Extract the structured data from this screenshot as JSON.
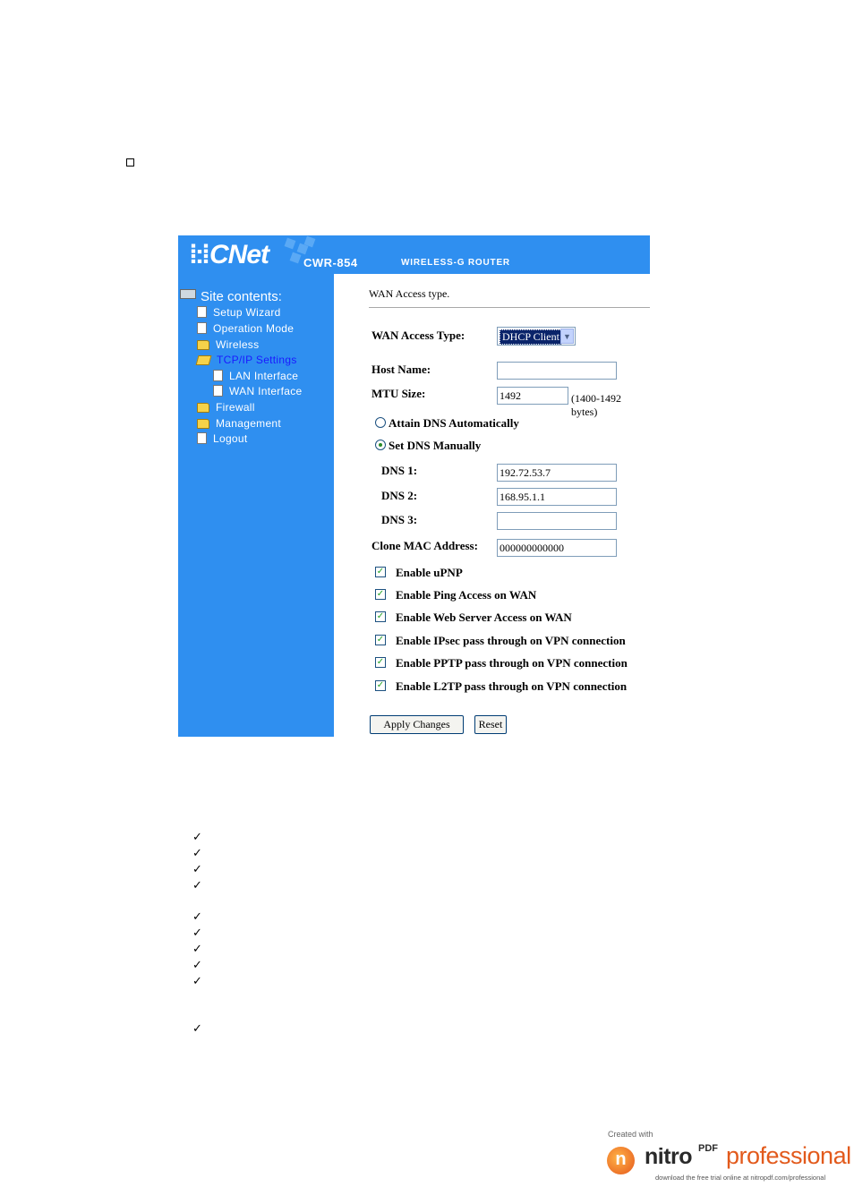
{
  "router": {
    "brand": "CNet",
    "model": "CWR-854",
    "subtitle": "WIRELESS-G ROUTER"
  },
  "sidebar": {
    "heading": "Site contents:",
    "items": [
      {
        "label": "Setup Wizard",
        "icon": "document-icon"
      },
      {
        "label": "Operation Mode",
        "icon": "document-icon"
      },
      {
        "label": "Wireless",
        "icon": "folder-icon"
      },
      {
        "label": "TCP/IP Settings",
        "icon": "folder-open-icon",
        "active": true
      },
      {
        "label": "LAN Interface",
        "icon": "document-icon"
      },
      {
        "label": "WAN Interface",
        "icon": "document-icon"
      },
      {
        "label": "Firewall",
        "icon": "folder-icon"
      },
      {
        "label": "Management",
        "icon": "folder-icon"
      },
      {
        "label": "Logout",
        "icon": "document-icon"
      }
    ]
  },
  "form": {
    "section_title": "WAN Access type.",
    "wan_access_type_label": "WAN Access Type:",
    "wan_access_type_value": "DHCP Client",
    "host_name_label": "Host Name:",
    "host_name_value": "",
    "mtu_label": "MTU Size:",
    "mtu_value": "1492",
    "mtu_hint": "(1400-1492 bytes)",
    "dns_auto_label": "Attain DNS Automatically",
    "dns_manual_label": "Set DNS Manually",
    "dns1_label": "DNS 1:",
    "dns1_value": "192.72.53.7",
    "dns2_label": "DNS 2:",
    "dns2_value": "168.95.1.1",
    "dns3_label": "DNS 3:",
    "dns3_value": "",
    "clone_mac_label": "Clone MAC Address:",
    "clone_mac_value": "000000000000",
    "checkboxes": [
      {
        "label": "Enable uPNP",
        "checked": true
      },
      {
        "label": "Enable Ping Access on WAN",
        "checked": true
      },
      {
        "label": "Enable Web Server Access on WAN",
        "checked": true
      },
      {
        "label": "Enable IPsec pass through on VPN connection",
        "checked": true
      },
      {
        "label": "Enable PPTP pass through on VPN connection",
        "checked": true
      },
      {
        "label": "Enable L2TP pass through on VPN connection",
        "checked": true
      }
    ],
    "apply_label": "Apply Changes",
    "reset_label": "Reset"
  },
  "check_glyph": "✓",
  "watermark": {
    "created": "Created with",
    "brand": "nitro",
    "brand_sup": "PDF",
    "product": "professional",
    "trial": "download the free trial online at nitropdf.com/professional"
  },
  "colors": {
    "router_blue": "#2f8ff0",
    "active_nav": "#1a1aff",
    "nitro_orange": "#e25a1c"
  }
}
